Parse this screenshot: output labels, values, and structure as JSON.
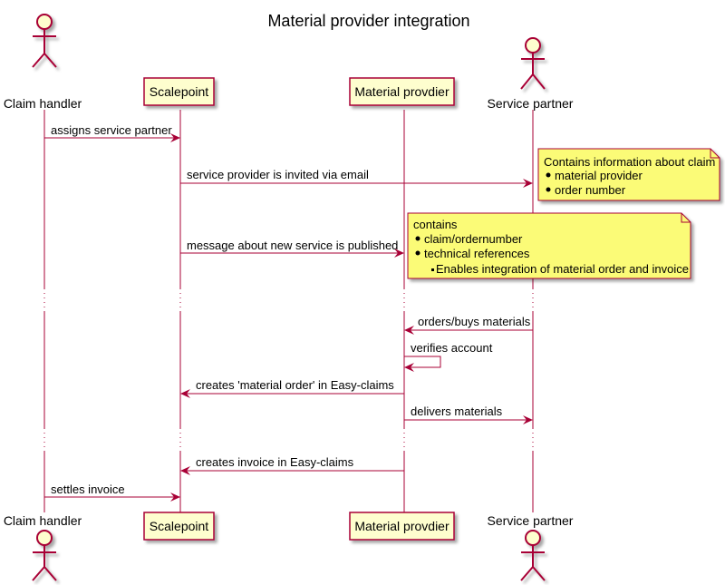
{
  "title": "Material provider integration",
  "colors": {
    "line": "#A80036",
    "participant_fill": "#FEFECE",
    "note_fill": "#FBFB77",
    "shadow": "#c8c8c8"
  },
  "participants": [
    {
      "id": "claim_handler",
      "label": "Claim handler",
      "kind": "actor"
    },
    {
      "id": "scalepoint",
      "label": "Scalepoint",
      "kind": "participant"
    },
    {
      "id": "material_provider",
      "label": "Material provdier",
      "kind": "participant"
    },
    {
      "id": "service_partner",
      "label": "Service partner",
      "kind": "actor"
    }
  ],
  "messages": [
    {
      "from": "claim_handler",
      "to": "scalepoint",
      "label": "assigns service partner"
    },
    {
      "from": "scalepoint",
      "to": "service_partner",
      "label": "service provider is invited via email"
    },
    {
      "from": "scalepoint",
      "to": "material_provider",
      "label": "message about new service is published"
    },
    {
      "from": "service_partner",
      "to": "material_provider",
      "label": "orders/buys materials"
    },
    {
      "from": "material_provider",
      "to": "material_provider",
      "label": "verifies account"
    },
    {
      "from": "material_provider",
      "to": "scalepoint",
      "label": "creates 'material order' in Easy-claims"
    },
    {
      "from": "material_provider",
      "to": "service_partner",
      "label": "delivers materials"
    },
    {
      "from": "material_provider",
      "to": "scalepoint",
      "label": "creates invoice in Easy-claims"
    },
    {
      "from": "claim_handler",
      "to": "scalepoint",
      "label": "settles invoice"
    }
  ],
  "notes": [
    {
      "attached_to": "service_partner",
      "heading": "Contains information about claim",
      "bullets": [
        "material provider",
        "order number"
      ],
      "sub_bullets": []
    },
    {
      "attached_to": "material_provider",
      "heading": "contains",
      "bullets": [
        "claim/ordernumber",
        "technical references"
      ],
      "sub_bullets": [
        "Enables integration of material order and invoice"
      ]
    }
  ]
}
